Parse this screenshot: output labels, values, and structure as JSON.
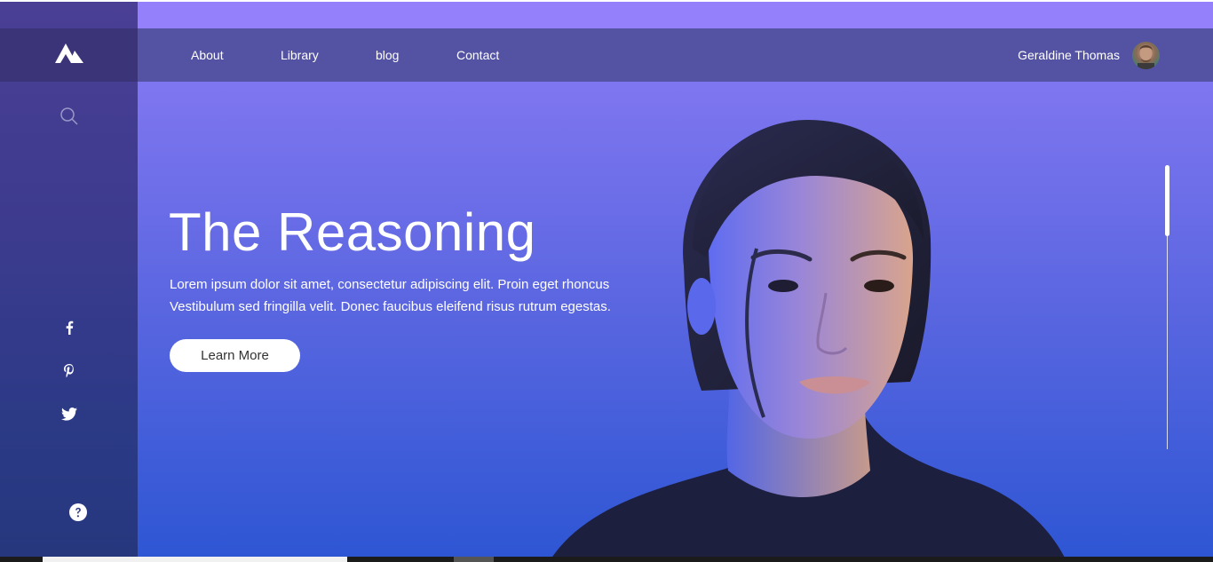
{
  "brand": {
    "logo_icon": "mountain-logo-icon"
  },
  "sidebar": {
    "search_icon": "search-icon",
    "social": [
      "facebook-icon",
      "pinterest-icon",
      "twitter-icon"
    ],
    "help_icon": "help-icon"
  },
  "nav": {
    "links": [
      "About",
      "Library",
      "blog",
      "Contact"
    ]
  },
  "user": {
    "name": "Geraldine Thomas",
    "avatar_icon": "user-avatar"
  },
  "hero": {
    "title": "The Reasoning",
    "text_line1": "Lorem ipsum dolor sit amet, consectetur adipiscing elit. Proin eget rhoncus",
    "text_line2": "Vestibulum sed fringilla velit. Donec faucibus eleifend risus rutrum egestas.",
    "button_label": "Learn More"
  },
  "colors": {
    "accent": "#8b7cf6",
    "navbar": "#5453a3",
    "sidebar": "#3d3b8e",
    "gradient_bottom": "#2e56d4"
  }
}
